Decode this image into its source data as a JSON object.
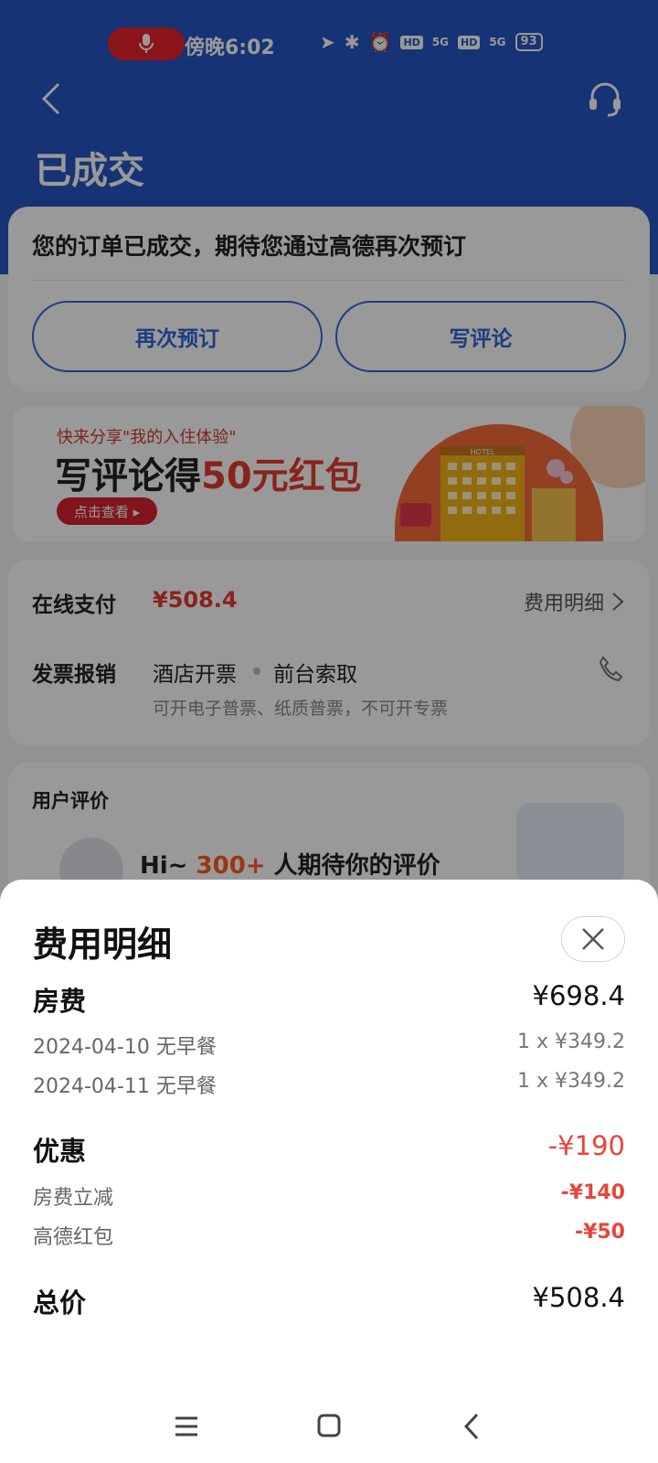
{
  "status_bar": {
    "time": "傍晚6:02",
    "battery": "93",
    "badges": [
      "HD",
      "5G",
      "HD",
      "5G"
    ]
  },
  "header": {
    "title": "已成交"
  },
  "order_card": {
    "message": "您的订单已成交，期待您通过高德再次预订",
    "rebook_label": "再次预订",
    "review_label": "写评论"
  },
  "banner": {
    "subtitle": "快来分享\"我的入住体验\"",
    "title_prefix": "写评论得",
    "title_highlight": "50元红包",
    "cta": "点击查看 ▸",
    "art_sign": "HOTEL"
  },
  "payment": {
    "label": "在线支付",
    "amount": "¥508.4",
    "detail_link": "费用明细",
    "invoice_label": "发票报销",
    "invoice_option_1": "酒店开票",
    "invoice_option_2": "前台索取",
    "invoice_note": "可开电子普票、纸质普票，不可开专票"
  },
  "reviews": {
    "label": "用户评价",
    "hi_prefix": "Hi~ ",
    "hi_count": "300+",
    "hi_suffix": " 人期待你的评价"
  },
  "fee_sheet": {
    "title": "费用明细",
    "room": {
      "label": "房费",
      "total": "¥698.4",
      "nights": [
        {
          "date": "2024-04-10  无早餐",
          "price": "1 x ¥349.2"
        },
        {
          "date": "2024-04-11  无早餐",
          "price": "1 x ¥349.2"
        }
      ]
    },
    "discount": {
      "label": "优惠",
      "total": "-¥190",
      "items": [
        {
          "name": "房费立减",
          "amount": "-¥140"
        },
        {
          "name": "高德红包",
          "amount": "-¥50"
        }
      ]
    },
    "total": {
      "label": "总价",
      "value": "¥508.4"
    }
  },
  "colors": {
    "header_blue": "#2356c4",
    "accent_blue": "#2f66d6",
    "price_red": "#e53b2f",
    "discount_red": "#e8453b",
    "orange": "#ff5a1f"
  },
  "icons": [
    "mic-icon",
    "back-icon",
    "headset-icon",
    "chevron-right-icon",
    "phone-icon",
    "close-icon",
    "menu-icon",
    "home-icon",
    "nav-back-icon"
  ]
}
